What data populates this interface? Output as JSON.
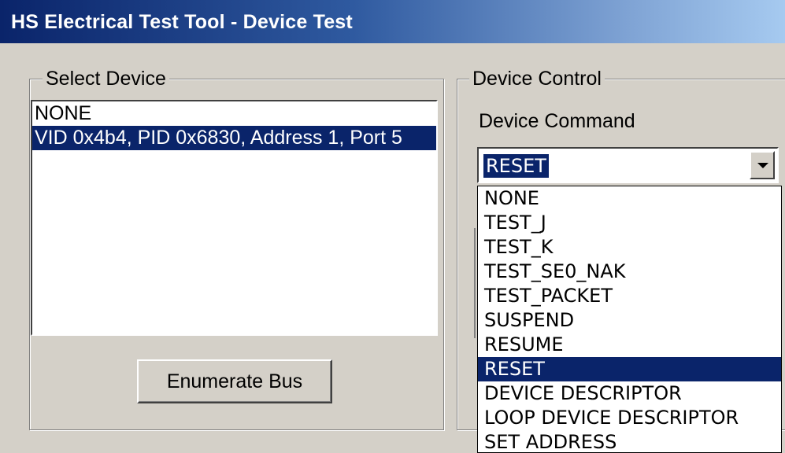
{
  "window": {
    "title": "HS Electrical Test Tool - Device Test"
  },
  "select_device": {
    "group_label": "Select Device",
    "devices": [
      {
        "label": "NONE",
        "selected": false
      },
      {
        "label": "VID 0x4b4, PID 0x6830, Address 1, Port 5",
        "selected": true
      }
    ],
    "enumerate_button": "Enumerate Bus"
  },
  "device_control": {
    "group_label": "Device Control",
    "command_label": "Device Command",
    "command_value": "RESET",
    "command_options": [
      {
        "label": "NONE",
        "selected": false
      },
      {
        "label": "TEST_J",
        "selected": false
      },
      {
        "label": "TEST_K",
        "selected": false
      },
      {
        "label": "TEST_SE0_NAK",
        "selected": false
      },
      {
        "label": "TEST_PACKET",
        "selected": false
      },
      {
        "label": "SUSPEND",
        "selected": false
      },
      {
        "label": "RESUME",
        "selected": false
      },
      {
        "label": "RESET",
        "selected": true
      },
      {
        "label": "DEVICE DESCRIPTOR",
        "selected": false
      },
      {
        "label": "LOOP DEVICE DESCRIPTOR",
        "selected": false
      },
      {
        "label": "SET ADDRESS",
        "selected": false
      }
    ]
  }
}
